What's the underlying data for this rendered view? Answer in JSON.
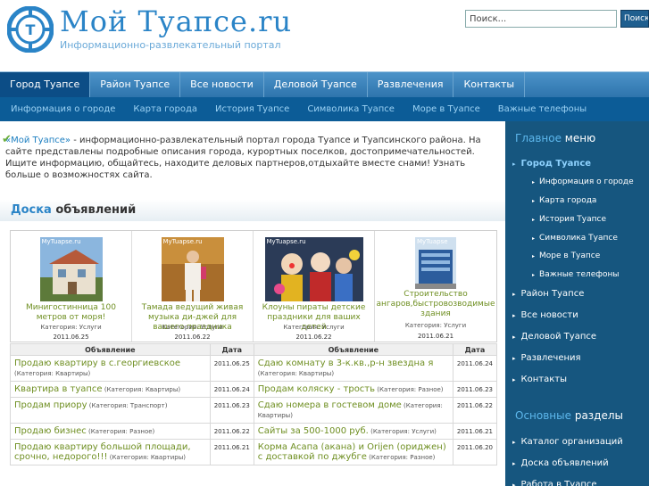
{
  "header": {
    "logo_title": "Мой Туапсе.ru",
    "logo_subtitle": "Информационно-развлекательный портал",
    "logo_letter": "Т"
  },
  "search": {
    "value": "Поиск...",
    "button_label": "Поиск"
  },
  "nav_main": [
    {
      "label": "Город Туапсе",
      "active": true
    },
    {
      "label": "Район Туапсе"
    },
    {
      "label": "Все новости"
    },
    {
      "label": "Деловой Туапсе"
    },
    {
      "label": "Развлечения"
    },
    {
      "label": "Контакты"
    }
  ],
  "nav_sub": [
    {
      "label": "Информация о городе"
    },
    {
      "label": "Карта города"
    },
    {
      "label": "История Туапсе"
    },
    {
      "label": "Символика Туапсе"
    },
    {
      "label": "Море в Туапсе"
    },
    {
      "label": "Важные телефоны"
    }
  ],
  "intro": {
    "link": "«Мой Туапсе»",
    "text": " - информационно-развлекательный портал города Туапсе и Туапсинского района. На сайте представлены подробные описания города, курортных поселков, достопримечательностей. Ищите информацию, общайтесь, находите деловых партнеров,отдыхайте вместе снами! Узнать больше о возможностях сайта."
  },
  "board": {
    "title_bold": "Доска",
    "title_rest": " объявлений"
  },
  "featured": [
    {
      "title": "Минигостинница 100 метров от моря!",
      "category": "Категория: Услуги",
      "date": "2011.06.25",
      "watermark": "MyTuapse.ru"
    },
    {
      "title": "Тамада ведущий живая музыка ди-джей для вашего праздника",
      "category": "Категория: Услуги",
      "date": "2011.06.22",
      "watermark": "MyTuapse.ru"
    },
    {
      "title": "Клоуны пираты детские праздники для ваших детей",
      "category": "Категория: Услуги",
      "date": "2011.06.22",
      "watermark": "MyTuapse.ru"
    },
    {
      "title": "Строительство ангаров,быстровозводимые здания",
      "category": "Категория: Услуги",
      "date": "2011.06.21",
      "watermark": "MyTuapse"
    }
  ],
  "listings": {
    "headers": [
      "Объявление",
      "Дата",
      "Объявление",
      "Дата"
    ],
    "rows": [
      [
        {
          "title": "Продаю квартиру в с.георгиевское",
          "category": " (Категория: Квартиры)",
          "date": "2011.06.25"
        },
        {
          "title": "Сдаю комнату в 3-к.кв.,р-н звездна я",
          "category": " (Категория: Квартиры)",
          "date": "2011.06.24"
        }
      ],
      [
        {
          "title": "Квартира в туапсе",
          "category": " (Категория: Квартиры)",
          "date": "2011.06.24"
        },
        {
          "title": "Продам коляску - трость",
          "category": " (Категория: Разное)",
          "date": "2011.06.23"
        }
      ],
      [
        {
          "title": "Продам приору",
          "category": " (Категория: Транспорт)",
          "date": "2011.06.23"
        },
        {
          "title": "Сдаю номера в гостевом доме",
          "category": " (Категория: Квартиры)",
          "date": "2011.06.22"
        }
      ],
      [
        {
          "title": "Продаю бизнес",
          "category": " (Категория: Разное)",
          "date": "2011.06.22"
        },
        {
          "title": "Сайты за 500-1000 руб.",
          "category": " (Категория: Услуги)",
          "date": "2011.06.21"
        }
      ],
      [
        {
          "title": "Продаю квартиру большой площади, срочно, недорого!!!",
          "category": " (Категория: Квартиры)",
          "date": "2011.06.21"
        },
        {
          "title": "Корма Асапа (акана) и Orijen (ориджен) с доставкой по джубге",
          "category": " (Категория: Разное)",
          "date": "2011.06.20"
        }
      ]
    ]
  },
  "sidebar": {
    "main_menu_bold": "Главное",
    "main_menu_rest": " меню",
    "items": [
      {
        "label": "Город Туапсе",
        "active": true
      },
      {
        "label": "Информация о городе",
        "sub": true
      },
      {
        "label": "Карта города",
        "sub": true
      },
      {
        "label": "История Туапсе",
        "sub": true
      },
      {
        "label": "Символика Туапсе",
        "sub": true
      },
      {
        "label": "Море в Туапсе",
        "sub": true
      },
      {
        "label": "Важные телефоны",
        "sub": true
      },
      {
        "label": "Район Туапсе"
      },
      {
        "label": "Все новости"
      },
      {
        "label": "Деловой Туапсе"
      },
      {
        "label": "Развлечения"
      },
      {
        "label": "Контакты"
      }
    ],
    "sections_bold": "Основные",
    "sections_rest": " разделы",
    "sections": [
      {
        "label": "Каталог организаций"
      },
      {
        "label": "Доска объявлений"
      },
      {
        "label": "Работа в Туапсе"
      }
    ]
  },
  "colors": {
    "brand_blue": "#2a84c7",
    "nav_active": "#0c4d86",
    "sidebar_bg": "#16567f",
    "listing_link": "#6f8f22"
  }
}
